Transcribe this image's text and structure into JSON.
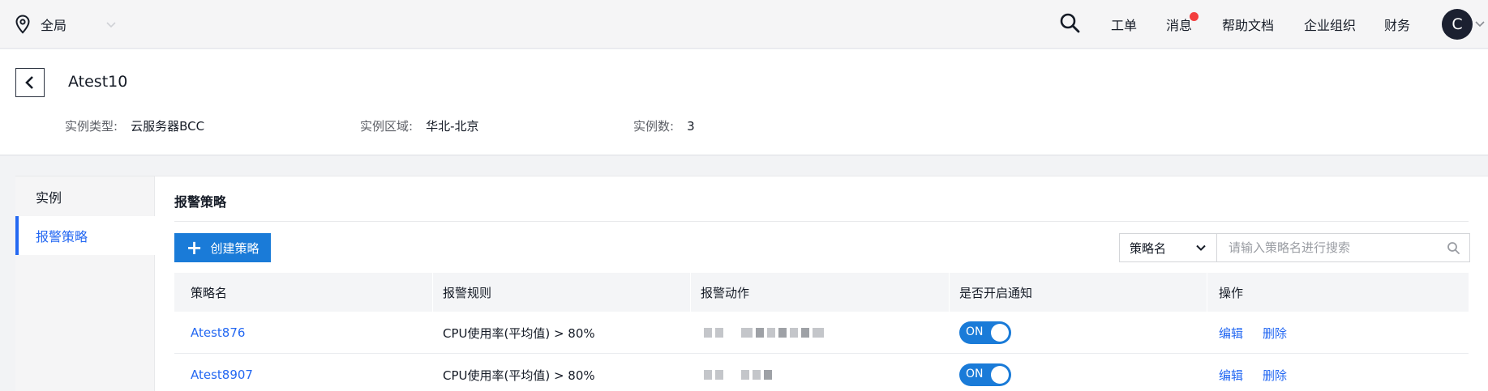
{
  "topbar": {
    "region_label": "全局",
    "nav": {
      "tickets": "工单",
      "messages": "消息",
      "help_docs": "帮助文档",
      "org": "企业组织",
      "finance": "财务"
    },
    "avatar_initial": "C"
  },
  "header": {
    "title": "Atest10",
    "meta": {
      "type_label": "实例类型:",
      "type_value": "云服务器BCC",
      "region_label": "实例区域:",
      "region_value": "华北-北京",
      "count_label": "实例数:",
      "count_value": "3"
    }
  },
  "sidebar": {
    "items": [
      {
        "label": "实例",
        "active": false
      },
      {
        "label": "报警策略",
        "active": true
      }
    ]
  },
  "main": {
    "section_title": "报警策略",
    "create_button": "创建策略",
    "search": {
      "select_value": "策略名",
      "placeholder": "请输入策略名进行搜索"
    },
    "table": {
      "columns": [
        "策略名",
        "报警规则",
        "报警动作",
        "是否开启通知",
        "操作"
      ],
      "rows": [
        {
          "name": "Atest876",
          "rule": "CPU使用率(平均值) > 80%",
          "action": "redacted",
          "notify": "ON",
          "edit": "编辑",
          "delete": "删除"
        },
        {
          "name": "Atest8907",
          "rule": "CPU使用率(平均值) > 80%",
          "action": "redacted",
          "notify": "ON",
          "edit": "编辑",
          "delete": "删除"
        }
      ]
    }
  },
  "colors": {
    "accent": "#2468f2",
    "primary_button": "#1a7bd8",
    "badge": "#f33e3e"
  }
}
